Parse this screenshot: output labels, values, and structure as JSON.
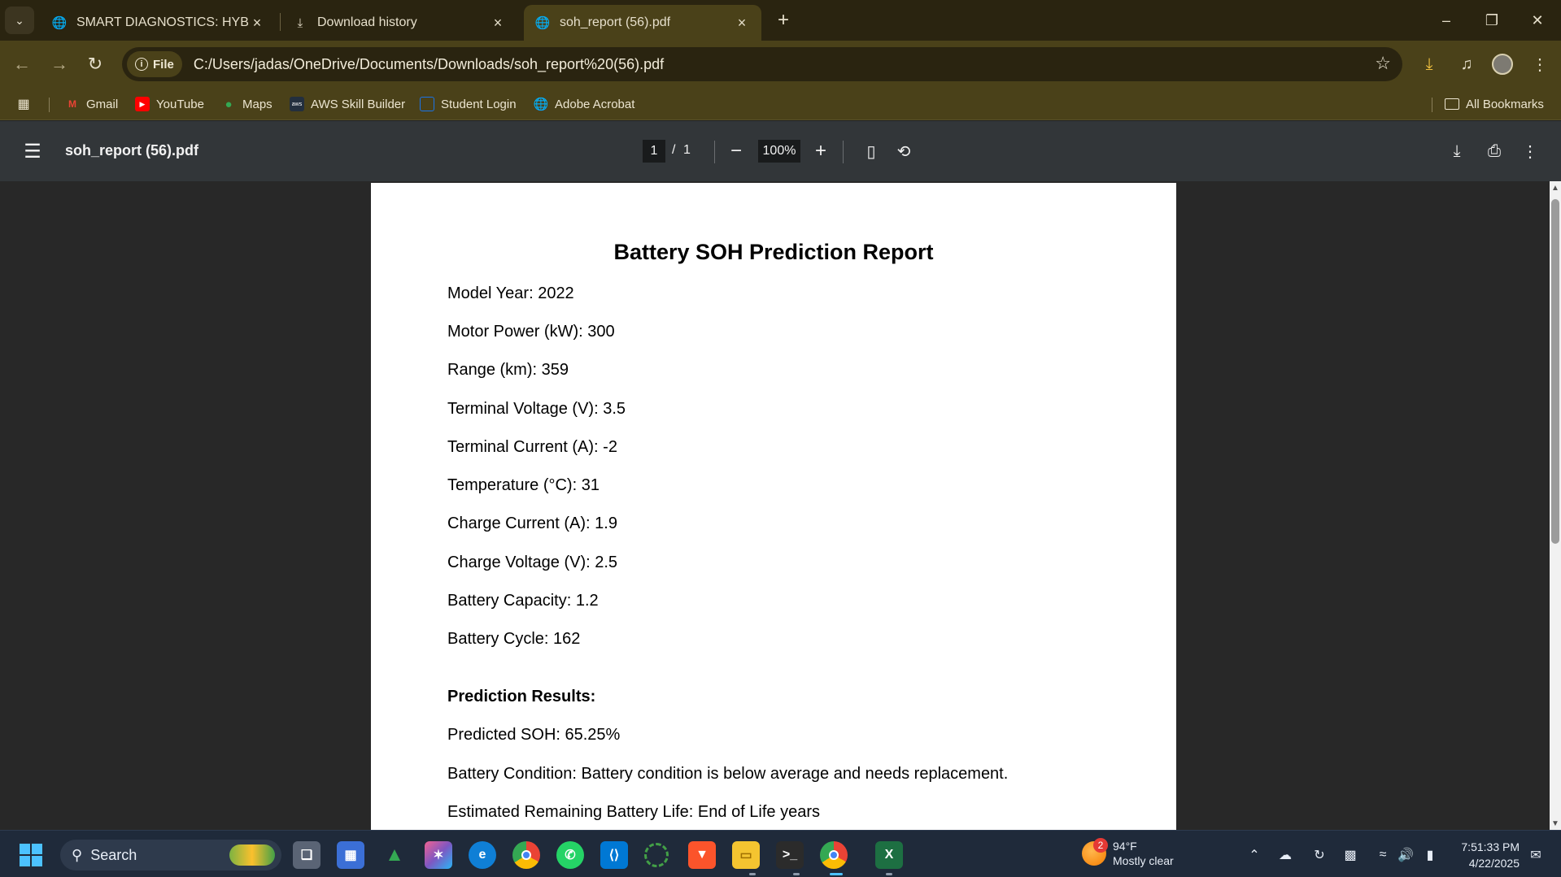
{
  "browser": {
    "tabs": [
      {
        "label": "SMART DIAGNOSTICS: HYBRID",
        "icon": "globe-icon"
      },
      {
        "label": "Download history",
        "icon": "download-icon"
      },
      {
        "label": "soh_report (56).pdf",
        "icon": "globe-icon"
      }
    ],
    "address": {
      "chip": "File",
      "url": "C:/Users/jadas/OneDrive/Documents/Downloads/soh_report%20(56).pdf"
    },
    "bookmarks": [
      {
        "label": "Gmail",
        "color": "#ea4335"
      },
      {
        "label": "YouTube",
        "color": "#ff0000"
      },
      {
        "label": "Maps",
        "color": "#34a853"
      },
      {
        "label": "AWS Skill Builder",
        "color": "#232f3e"
      },
      {
        "label": "Student Login",
        "color": "#1a73e8"
      },
      {
        "label": "Adobe Acrobat",
        "color": "#d0d0d0"
      }
    ],
    "all_bookmarks": "All Bookmarks",
    "theme": {
      "frame": "#2a2410",
      "toolbar": "#4a4119"
    }
  },
  "pdf_viewer": {
    "filename": "soh_report (56).pdf",
    "page_current": "1",
    "page_sep": "/",
    "page_total": "1",
    "zoom": "100%"
  },
  "document": {
    "title": "Battery SOH Prediction Report",
    "fields": [
      "Model Year: 2022",
      "Motor Power (kW): 300",
      "Range (km): 359",
      "Terminal Voltage (V): 3.5",
      "Terminal Current (A): -2",
      "Temperature (°C): 31",
      "Charge Current (A): 1.9",
      "Charge Voltage (V): 2.5",
      "Battery Capacity: 1.2",
      "Battery Cycle: 162"
    ],
    "results_heading": "Prediction Results:",
    "results": [
      "Predicted SOH: 65.25%",
      "Battery Condition: Battery condition is below average and needs replacement.",
      "Estimated Remaining Battery Life: End of Life years"
    ]
  },
  "taskbar": {
    "search_label": "Search",
    "weather": {
      "badge": "2",
      "temp": "94°F",
      "condition": "Mostly clear"
    },
    "clock": {
      "time": "7:51:33 PM",
      "date": "4/22/2025"
    }
  }
}
